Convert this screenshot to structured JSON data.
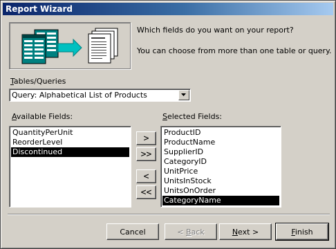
{
  "window": {
    "title": "Report Wizard"
  },
  "intro": {
    "question": "Which fields do you want on your report?",
    "hint": "You can choose from more than one table or query."
  },
  "tables_queries": {
    "label_underlined": "T",
    "label_rest": "ables/Queries",
    "selected": "Query: Alphabetical List of Products",
    "dropdown_icon": "chevron-down-icon"
  },
  "available_fields": {
    "label_underlined": "A",
    "label_rest": "vailable Fields:",
    "items": [
      "QuantityPerUnit",
      "ReorderLevel",
      "Discontinued"
    ],
    "selected": "Discontinued"
  },
  "selected_fields": {
    "label_underlined": "S",
    "label_rest": "elected Fields:",
    "items": [
      "ProductID",
      "ProductName",
      "SupplierID",
      "CategoryID",
      "UnitPrice",
      "UnitsInStock",
      "UnitsOnOrder",
      "CategoryName"
    ],
    "selected": "CategoryName"
  },
  "move_buttons": {
    "add_one": ">",
    "add_all": ">>",
    "remove_one": "<",
    "remove_all": "<<"
  },
  "footer_buttons": {
    "cancel": "Cancel",
    "back_prefix": "< ",
    "back_underlined": "B",
    "back_rest": "ack",
    "next_underlined": "N",
    "next_rest": "ext >",
    "finish_underlined": "F",
    "finish_rest": "inish"
  },
  "colors": {
    "titlebar_start": "#0a246a",
    "titlebar_end": "#a6caf0",
    "face": "#d4d0c8",
    "selection": "#000000",
    "arrow": "#00c0c0"
  }
}
